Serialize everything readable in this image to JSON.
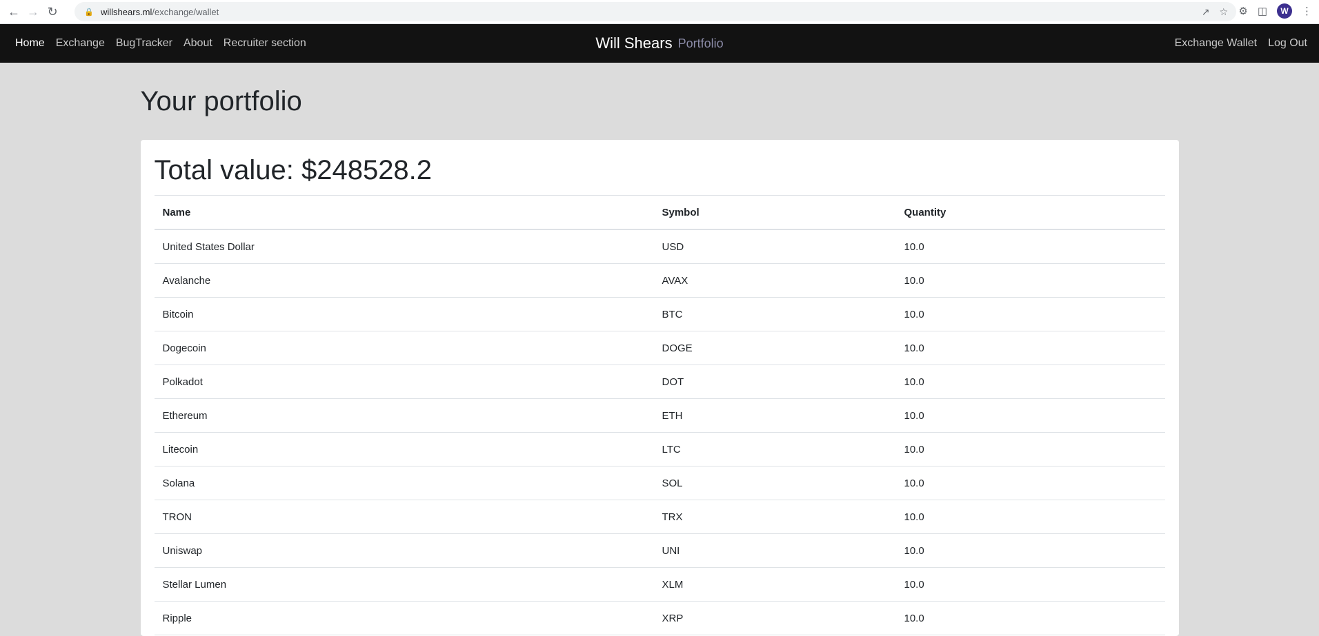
{
  "browser": {
    "url_host": "willshears.ml",
    "url_path": "/exchange/wallet",
    "avatar_initial": "W"
  },
  "navbar": {
    "left_links": [
      "Home",
      "Exchange",
      "BugTracker",
      "About",
      "Recruiter section"
    ],
    "brand_name": "Will Shears",
    "brand_sub": "Portfolio",
    "right_links": [
      "Exchange Wallet",
      "Log Out"
    ]
  },
  "page": {
    "title": "Your portfolio",
    "total_value": "Total value: $248528.2"
  },
  "table": {
    "headers": [
      "Name",
      "Symbol",
      "Quantity"
    ],
    "rows": [
      [
        "United States Dollar",
        "USD",
        "10.0"
      ],
      [
        "Avalanche",
        "AVAX",
        "10.0"
      ],
      [
        "Bitcoin",
        "BTC",
        "10.0"
      ],
      [
        "Dogecoin",
        "DOGE",
        "10.0"
      ],
      [
        "Polkadot",
        "DOT",
        "10.0"
      ],
      [
        "Ethereum",
        "ETH",
        "10.0"
      ],
      [
        "Litecoin",
        "LTC",
        "10.0"
      ],
      [
        "Solana",
        "SOL",
        "10.0"
      ],
      [
        "TRON",
        "TRX",
        "10.0"
      ],
      [
        "Uniswap",
        "UNI",
        "10.0"
      ],
      [
        "Stellar Lumen",
        "XLM",
        "10.0"
      ],
      [
        "Ripple",
        "XRP",
        "10.0"
      ]
    ]
  },
  "colors": {
    "navbar_bg": "#121212",
    "page_bg": "#dcdcdc",
    "brand_sub": "#8c8ca8"
  }
}
